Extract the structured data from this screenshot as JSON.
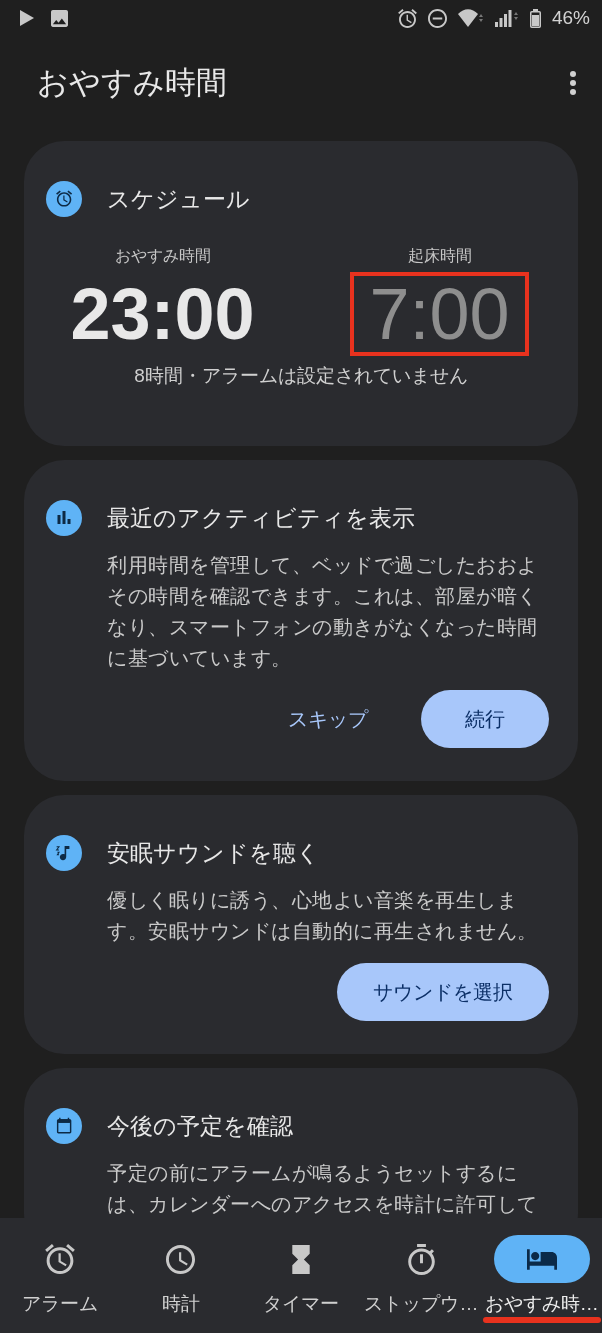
{
  "status_bar": {
    "battery": "46%"
  },
  "app_bar": {
    "title": "おやすみ時間"
  },
  "schedule": {
    "title": "スケジュール",
    "times": [
      {
        "label": "おやすみ時間",
        "time": "23:00",
        "active": true,
        "highlighted": false
      },
      {
        "label": "起床時間",
        "time": "7:00",
        "active": false,
        "highlighted": true
      }
    ],
    "summary": "8時間・アラームは設定されていません"
  },
  "cards": [
    {
      "title": "最近のアクティビティを表示",
      "body": "利用時間を管理して、ベッドで過ごしたおおよその時間を確認できます。これは、部屋が暗くなり、スマートフォンの動きがなくなった時間に基づいています。",
      "buttons": [
        {
          "label": "スキップ",
          "kind": "text"
        },
        {
          "label": "続行",
          "kind": "filled"
        }
      ]
    },
    {
      "title": "安眠サウンドを聴く",
      "body": "優しく眠りに誘う、心地よい音楽を再生します。安眠サウンドは自動的に再生されません。",
      "buttons": [
        {
          "label": "サウンドを選択",
          "kind": "filled"
        }
      ]
    },
    {
      "title": "今後の予定を確認",
      "body": "予定の前にアラームが鳴るようセットするには、カレンダーへのアクセスを時計に許可して"
    }
  ],
  "nav": {
    "tabs": [
      {
        "label": "アラーム",
        "selected": false,
        "highlighted": false
      },
      {
        "label": "時計",
        "selected": false,
        "highlighted": false
      },
      {
        "label": "タイマー",
        "selected": false,
        "highlighted": false
      },
      {
        "label": "ストップウ…",
        "selected": false,
        "highlighted": false
      },
      {
        "label": "おやすみ時…",
        "selected": true,
        "highlighted": true
      }
    ]
  }
}
